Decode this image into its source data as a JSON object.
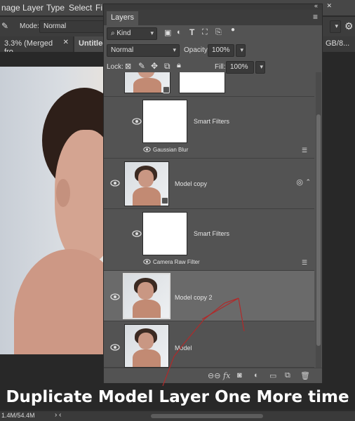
{
  "menu": {
    "items": [
      "nage",
      "Layer",
      "Type",
      "Select",
      "Fi"
    ]
  },
  "options": {
    "mode_label": "Mode:",
    "mode_value": "Normal"
  },
  "tabs": {
    "doc1": "3.3% (Merged fro...",
    "doc2": "Untitled",
    "doc3": "GB/8..."
  },
  "panel": {
    "title": "Layers",
    "filter_kind": "Kind",
    "blend_mode": "Normal",
    "opacity_label": "Opacity:",
    "opacity_value": "100%",
    "lock_label": "Lock:",
    "fill_label": "Fill:",
    "fill_value": "100%"
  },
  "layers": [
    {
      "name": "Smart Filters",
      "filter": "Gaussian Blur"
    },
    {
      "name": "Model  copy"
    },
    {
      "name": "Smart Filters",
      "filter": "Camera Raw Filter"
    },
    {
      "name": "Model  copy 2"
    },
    {
      "name": "Model"
    }
  ],
  "status": {
    "size": "1.4M/54.4M"
  },
  "caption": "Duplicate Model Layer One More time",
  "colors": {
    "panel_bg": "#535353",
    "selected_row": "#6a6a6a",
    "arrow": "#b02a2a"
  }
}
